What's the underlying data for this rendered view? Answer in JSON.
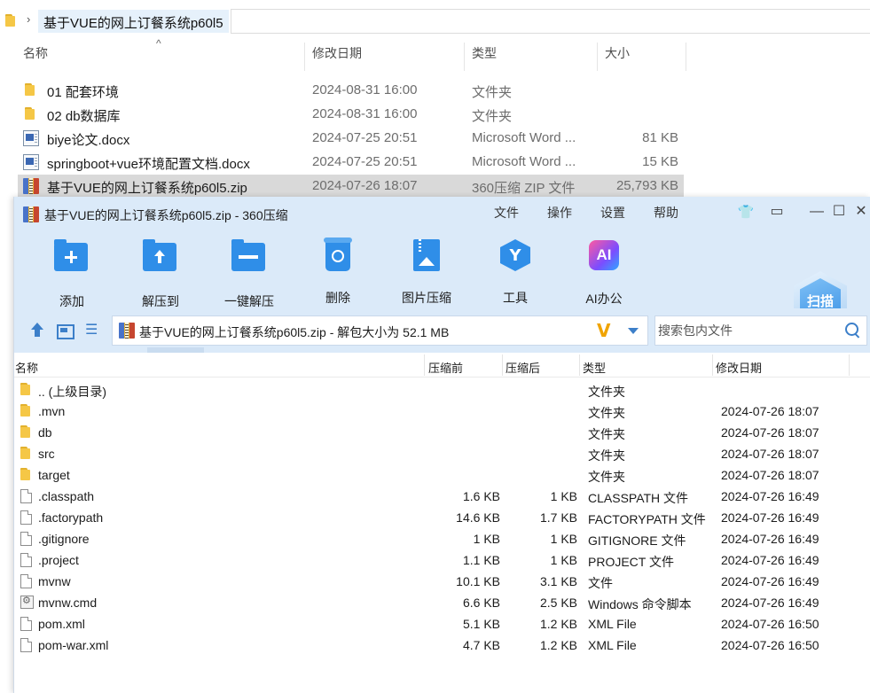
{
  "explorer": {
    "breadcrumb": "基于VUE的网上订餐系统p60l5",
    "columns": {
      "name": "名称",
      "date": "修改日期",
      "type": "类型",
      "size": "大小"
    },
    "rows": [
      {
        "icon": "folder-icon",
        "name": "01 配套环境",
        "date": "2024-08-31 16:00",
        "type": "文件夹",
        "size": ""
      },
      {
        "icon": "folder-icon",
        "name": "02 db数据库",
        "date": "2024-08-31 16:00",
        "type": "文件夹",
        "size": ""
      },
      {
        "icon": "docx-icon",
        "name": "biye论文.docx",
        "date": "2024-07-25 20:51",
        "type": "Microsoft Word ...",
        "size": "81 KB"
      },
      {
        "icon": "docx-icon",
        "name": "springboot+vue环境配置文档.docx",
        "date": "2024-07-25 20:51",
        "type": "Microsoft Word ...",
        "size": "15 KB"
      },
      {
        "icon": "zip-icon",
        "name": "基于VUE的网上订餐系统p60l5.zip",
        "date": "2024-07-26 18:07",
        "type": "360压缩 ZIP 文件",
        "size": "25,793 KB",
        "selected": true
      }
    ]
  },
  "zip": {
    "title": "基于VUE的网上订餐系统p60l5.zip - 360压缩",
    "menu": {
      "file": "文件",
      "operate": "操作",
      "settings": "设置",
      "help": "帮助"
    },
    "window_controls": {
      "skin": "👕",
      "feedback": "▭",
      "minimize": "—",
      "maximize": "☐",
      "close": "✕"
    },
    "toolbar": {
      "add": "添加",
      "extract_to": "解压到",
      "one_click_extract": "一键解压",
      "delete": "删除",
      "image_compress": "图片压缩",
      "tools": "工具",
      "ai_office": "AI办公",
      "ai_icon_text": "AI",
      "tools_icon_text": "Y",
      "scan": "扫描"
    },
    "path": "基于VUE的网上订餐系统p60l5.zip - 解包大小为 52.1 MB",
    "path_brand": "V",
    "search": {
      "placeholder": "搜索包内文件",
      "value": ""
    },
    "columns": {
      "name": "名称",
      "compressed_before": "压缩前",
      "compressed_after": "压缩后",
      "type": "类型",
      "modified": "修改日期"
    },
    "rows": [
      {
        "icon": "folder-icon",
        "name": ".. (上级目录)",
        "before": "",
        "after": "",
        "type": "文件夹",
        "date": ""
      },
      {
        "icon": "folder-icon",
        "name": ".mvn",
        "before": "",
        "after": "",
        "type": "文件夹",
        "date": "2024-07-26 18:07"
      },
      {
        "icon": "folder-icon",
        "name": "db",
        "before": "",
        "after": "",
        "type": "文件夹",
        "date": "2024-07-26 18:07"
      },
      {
        "icon": "folder-icon",
        "name": "src",
        "before": "",
        "after": "",
        "type": "文件夹",
        "date": "2024-07-26 18:07"
      },
      {
        "icon": "folder-icon",
        "name": "target",
        "before": "",
        "after": "",
        "type": "文件夹",
        "date": "2024-07-26 18:07"
      },
      {
        "icon": "file-icon",
        "name": ".classpath",
        "before": "1.6 KB",
        "after": "1 KB",
        "type": "CLASSPATH 文件",
        "date": "2024-07-26 16:49"
      },
      {
        "icon": "file-icon",
        "name": ".factorypath",
        "before": "14.6 KB",
        "after": "1.7 KB",
        "type": "FACTORYPATH 文件",
        "date": "2024-07-26 16:49"
      },
      {
        "icon": "file-icon",
        "name": ".gitignore",
        "before": "1 KB",
        "after": "1 KB",
        "type": "GITIGNORE 文件",
        "date": "2024-07-26 16:49"
      },
      {
        "icon": "file-icon",
        "name": ".project",
        "before": "1.1 KB",
        "after": "1 KB",
        "type": "PROJECT 文件",
        "date": "2024-07-26 16:49"
      },
      {
        "icon": "file-icon",
        "name": "mvnw",
        "before": "10.1 KB",
        "after": "3.1 KB",
        "type": "文件",
        "date": "2024-07-26 16:49"
      },
      {
        "icon": "cmd-icon",
        "name": "mvnw.cmd",
        "before": "6.6 KB",
        "after": "2.5 KB",
        "type": "Windows 命令脚本",
        "date": "2024-07-26 16:49"
      },
      {
        "icon": "file-icon",
        "name": "pom.xml",
        "before": "5.1 KB",
        "after": "1.2 KB",
        "type": "XML File",
        "date": "2024-07-26 16:50"
      },
      {
        "icon": "file-icon",
        "name": "pom-war.xml",
        "before": "4.7 KB",
        "after": "1.2 KB",
        "type": "XML File",
        "date": "2024-07-26 16:50"
      }
    ]
  }
}
